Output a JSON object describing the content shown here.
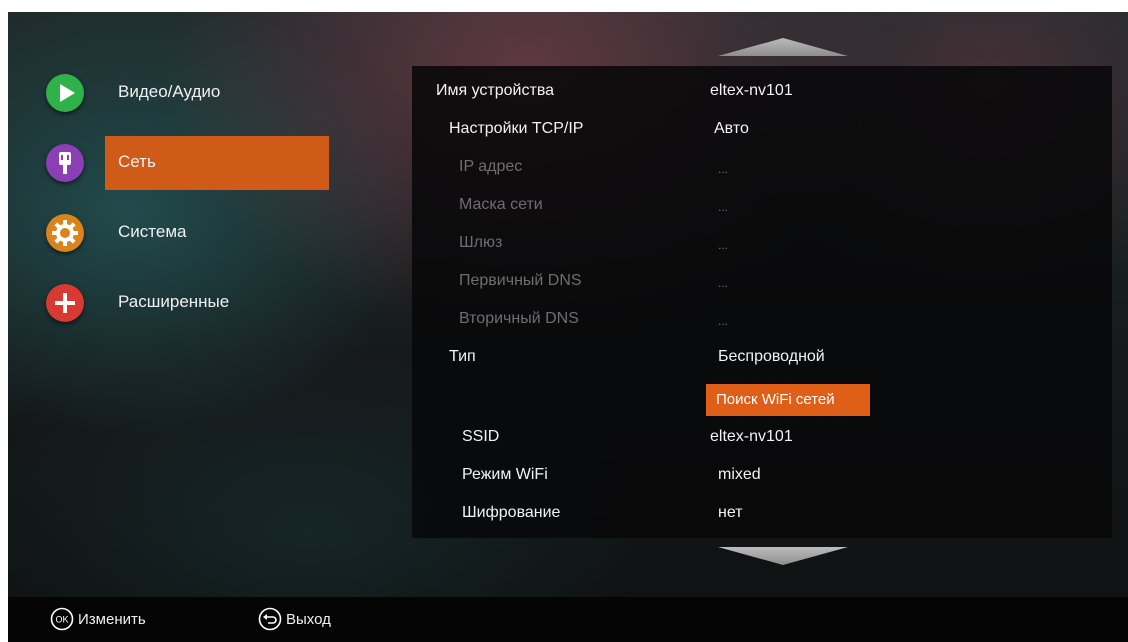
{
  "menu": {
    "items": [
      {
        "label": "Видео/Аудио",
        "icon": "play-icon",
        "color": "#2fb24a"
      },
      {
        "label": "Сеть",
        "icon": "network-plug-icon",
        "color": "#8a3fb5",
        "selected": true
      },
      {
        "label": "Система",
        "icon": "gear-icon",
        "color": "#d9841d"
      },
      {
        "label": "Расширенные",
        "icon": "plus-icon",
        "color": "#d63a32"
      }
    ]
  },
  "settings": {
    "device_name": {
      "label": "Имя устройства",
      "value": "eltex-nv101"
    },
    "tcpip": {
      "label": "Настройки TCP/IP",
      "value": "Авто"
    },
    "ip": {
      "label": "IP адрес",
      "value": "..."
    },
    "mask": {
      "label": "Маска сети",
      "value": "..."
    },
    "gateway": {
      "label": "Шлюз",
      "value": "..."
    },
    "dns1": {
      "label": "Первичный DNS",
      "value": "..."
    },
    "dns2": {
      "label": "Вторичный DNS",
      "value": "..."
    },
    "type": {
      "label": "Тип",
      "value": "Беспроводной"
    },
    "wifi_search": {
      "label": "Поиск WiFi сетей"
    },
    "ssid": {
      "label": "SSID",
      "value": "eltex-nv101"
    },
    "wifi_mode": {
      "label": "Режим WiFi",
      "value": "mixed"
    },
    "encryption": {
      "label": "Шифрование",
      "value": "нет"
    }
  },
  "footer": {
    "ok_icon_text": "OK",
    "change_label": "Изменить",
    "exit_label": "Выход"
  },
  "colors": {
    "accent": "#d05a17",
    "button": "#e05f18"
  }
}
